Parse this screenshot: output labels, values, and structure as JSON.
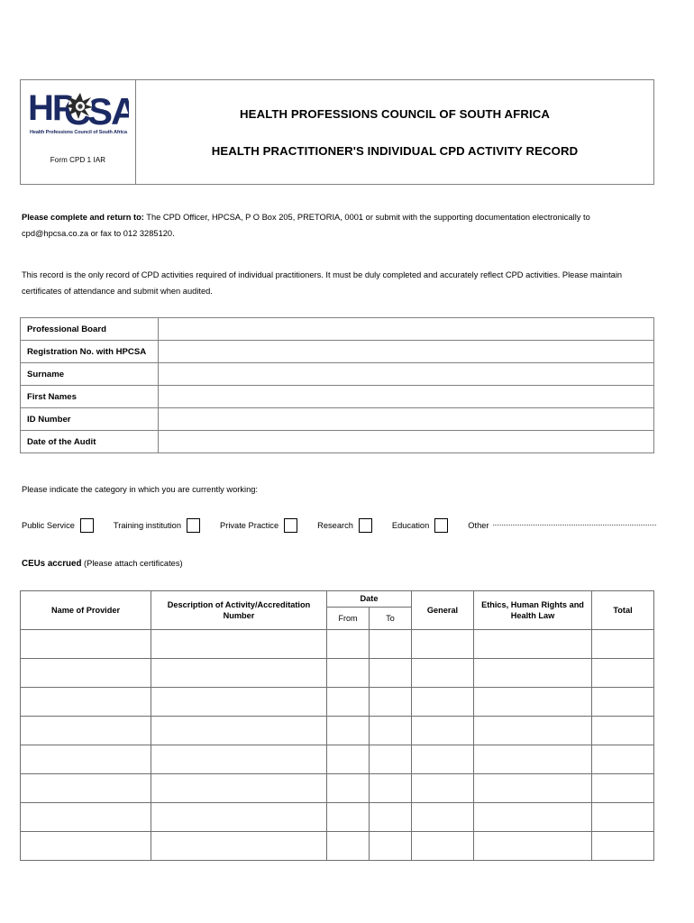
{
  "document": {
    "form_code": "Form CPD 1 IAR",
    "logo": {
      "wordmark": "HPCSA",
      "tagline": "Health Professions Council of South Africa",
      "color": "#1b2a63"
    },
    "title_line_1": "HEALTH PROFESSIONS COUNCIL OF SOUTH AFRICA",
    "title_line_2": "HEALTH PRACTITIONER'S INDIVIDUAL CPD ACTIVITY RECORD"
  },
  "instructions": {
    "return_label": "Please complete and return to:",
    "return_text": " The CPD Officer, HPCSA, P O Box 205, PRETORIA, 0001 or submit with the supporting documentation electronically to cpd@hpcsa.co.za or fax to 012 3285120.",
    "record_note": "This record is the only record of CPD activities required of individual practitioners.  It must be duly completed and accurately reflect CPD activities.  Please maintain certificates of attendance and submit when audited."
  },
  "details": {
    "rows": [
      {
        "label": "Professional Board",
        "value": ""
      },
      {
        "label": "Registration No. with HPCSA",
        "value": ""
      },
      {
        "label": "Surname",
        "value": ""
      },
      {
        "label": "First Names",
        "value": ""
      },
      {
        "label": "ID Number",
        "value": ""
      },
      {
        "label": "Date of the Audit",
        "value": ""
      }
    ]
  },
  "category": {
    "prompt": "Please indicate the category in which you are currently working:",
    "options": [
      {
        "label": "Public Service",
        "checked": false
      },
      {
        "label": "Training institution",
        "checked": false
      },
      {
        "label": "Private Practice",
        "checked": false
      },
      {
        "label": "Research",
        "checked": false
      },
      {
        "label": "Education",
        "checked": false
      },
      {
        "label": "Other",
        "checked": false
      }
    ]
  },
  "ceus": {
    "heading_bold": "CEUs accrued",
    "heading_normal": " (Please attach certificates)"
  },
  "activity_table": {
    "headers": {
      "provider": "Name of Provider",
      "description": "Description of Activity/Accreditation Number",
      "date": "Date",
      "from": "From",
      "to": "To",
      "general": "General",
      "ethics": "Ethics, Human Rights and Health Law",
      "total": "Total"
    },
    "rows": [
      {
        "provider": "",
        "description": "",
        "from": "",
        "to": "",
        "general": "",
        "ethics": "",
        "total": ""
      },
      {
        "provider": "",
        "description": "",
        "from": "",
        "to": "",
        "general": "",
        "ethics": "",
        "total": ""
      },
      {
        "provider": "",
        "description": "",
        "from": "",
        "to": "",
        "general": "",
        "ethics": "",
        "total": ""
      },
      {
        "provider": "",
        "description": "",
        "from": "",
        "to": "",
        "general": "",
        "ethics": "",
        "total": ""
      },
      {
        "provider": "",
        "description": "",
        "from": "",
        "to": "",
        "general": "",
        "ethics": "",
        "total": ""
      },
      {
        "provider": "",
        "description": "",
        "from": "",
        "to": "",
        "general": "",
        "ethics": "",
        "total": ""
      },
      {
        "provider": "",
        "description": "",
        "from": "",
        "to": "",
        "general": "",
        "ethics": "",
        "total": ""
      },
      {
        "provider": "",
        "description": "",
        "from": "",
        "to": "",
        "general": "",
        "ethics": "",
        "total": ""
      }
    ]
  }
}
